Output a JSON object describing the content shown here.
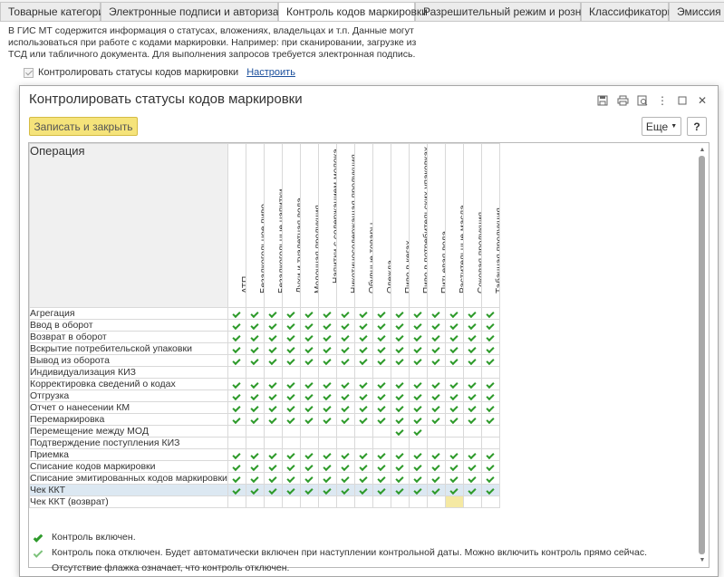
{
  "tabs": [
    {
      "label": "Товарные категории",
      "active": false
    },
    {
      "label": "Электронные подписи и авторизация",
      "active": false
    },
    {
      "label": "Контроль кодов маркировки",
      "active": true
    },
    {
      "label": "Разрешительный режим и розница",
      "active": false
    },
    {
      "label": "Классификаторы",
      "active": false
    },
    {
      "label": "Эмиссия кодов",
      "active": false
    }
  ],
  "background": {
    "info_text": "В ГИС МТ содержится информация о статусах, вложениях, владельцах и т.п. Данные могут использоваться при работе с кодами маркировки. Например: при сканировании, загрузке из ТСД или табличного документа. Для выполнения запросов требуется электронная подпись.",
    "checkbox_label": "Контролировать статусы кодов маркировки",
    "settings_link": "Настроить"
  },
  "dialog": {
    "title": "Контролировать статусы кодов маркировки",
    "save_button": "Записать и закрыть",
    "more_button": "Еще",
    "help_button": "?",
    "operation_header": "Операция"
  },
  "columns": [
    "АТП",
    "Безалкогольное пиво",
    "Безалкогольные напитки",
    "Духи и туалетная вода",
    "Молочная продукция",
    "Напитки с содержанием молока,\nкакао, прочие",
    "Никотиносодержащая продукция",
    "Обувные товары",
    "Одежда",
    "Пиво в кегах",
    "Пиво в потребительских упаковках",
    "Питьевая вода",
    "Растительные масла",
    "Соковая продукция",
    "Табачная продукция"
  ],
  "rows": [
    {
      "operation": "Агрегация",
      "checks": [
        1,
        1,
        1,
        1,
        1,
        1,
        1,
        1,
        1,
        1,
        1,
        1,
        1,
        1,
        1
      ]
    },
    {
      "operation": "Ввод в оборот",
      "checks": [
        1,
        1,
        1,
        1,
        1,
        1,
        1,
        1,
        1,
        1,
        1,
        1,
        1,
        1,
        1
      ]
    },
    {
      "operation": "Возврат в оборот",
      "checks": [
        1,
        1,
        1,
        1,
        1,
        1,
        1,
        1,
        1,
        1,
        1,
        1,
        1,
        1,
        1
      ]
    },
    {
      "operation": "Вскрытие потребительской упаковки",
      "checks": [
        1,
        1,
        1,
        1,
        1,
        1,
        1,
        1,
        1,
        1,
        1,
        1,
        1,
        1,
        1
      ]
    },
    {
      "operation": "Вывод из оборота",
      "checks": [
        1,
        1,
        1,
        1,
        1,
        1,
        1,
        1,
        1,
        1,
        1,
        1,
        1,
        1,
        1
      ]
    },
    {
      "operation": "Индивидуализация КИЗ",
      "checks": [
        0,
        0,
        0,
        0,
        0,
        0,
        0,
        0,
        0,
        0,
        0,
        0,
        0,
        0,
        0
      ]
    },
    {
      "operation": "Корректировка сведений о кодах",
      "checks": [
        1,
        1,
        1,
        1,
        1,
        1,
        1,
        1,
        1,
        1,
        1,
        1,
        1,
        1,
        1
      ]
    },
    {
      "operation": "Отгрузка",
      "checks": [
        1,
        1,
        1,
        1,
        1,
        1,
        1,
        1,
        1,
        1,
        1,
        1,
        1,
        1,
        1
      ]
    },
    {
      "operation": "Отчет о нанесении КМ",
      "checks": [
        1,
        1,
        1,
        1,
        1,
        1,
        1,
        1,
        1,
        1,
        1,
        1,
        1,
        1,
        1
      ]
    },
    {
      "operation": "Перемаркировка",
      "checks": [
        1,
        1,
        1,
        1,
        1,
        1,
        1,
        1,
        1,
        1,
        1,
        1,
        1,
        1,
        1
      ]
    },
    {
      "operation": "Перемещение между МОД",
      "checks": [
        0,
        0,
        0,
        0,
        0,
        0,
        0,
        0,
        0,
        1,
        1,
        0,
        0,
        0,
        0
      ]
    },
    {
      "operation": "Подтверждение поступления КИЗ",
      "checks": [
        0,
        0,
        0,
        0,
        0,
        0,
        0,
        0,
        0,
        0,
        0,
        0,
        0,
        0,
        0
      ]
    },
    {
      "operation": "Приемка",
      "checks": [
        1,
        1,
        1,
        1,
        1,
        1,
        1,
        1,
        1,
        1,
        1,
        1,
        1,
        1,
        1
      ]
    },
    {
      "operation": "Списание кодов маркировки",
      "checks": [
        1,
        1,
        1,
        1,
        1,
        1,
        1,
        1,
        1,
        1,
        1,
        1,
        1,
        1,
        1
      ]
    },
    {
      "operation": "Списание эмитированных кодов маркировки",
      "checks": [
        1,
        1,
        1,
        1,
        1,
        1,
        1,
        1,
        1,
        1,
        1,
        1,
        1,
        1,
        1
      ]
    },
    {
      "operation": "Чек ККТ",
      "checks": [
        1,
        1,
        1,
        1,
        1,
        1,
        1,
        1,
        1,
        1,
        1,
        1,
        1,
        1,
        1
      ],
      "selected": true
    },
    {
      "operation": "Чек ККТ (возврат)",
      "checks": [
        0,
        0,
        0,
        0,
        0,
        0,
        0,
        0,
        0,
        0,
        0,
        0,
        0,
        0,
        0
      ],
      "highlight_col": 12
    }
  ],
  "legend": [
    {
      "icon": "check-filled-icon",
      "text": "Контроль включен."
    },
    {
      "icon": "check-outline-icon",
      "text": "Контроль пока отключен. Будет автоматически включен при наступлении контрольной даты. Можно включить контроль прямо сейчас."
    },
    {
      "icon": "",
      "text": "Отсутствие флажка означает, что контроль отключен."
    }
  ],
  "colors": {
    "check": "#2d9a2a",
    "save_button": "#f5e37a",
    "selected_row": "#dce8f2",
    "link": "#1b4f9c"
  }
}
